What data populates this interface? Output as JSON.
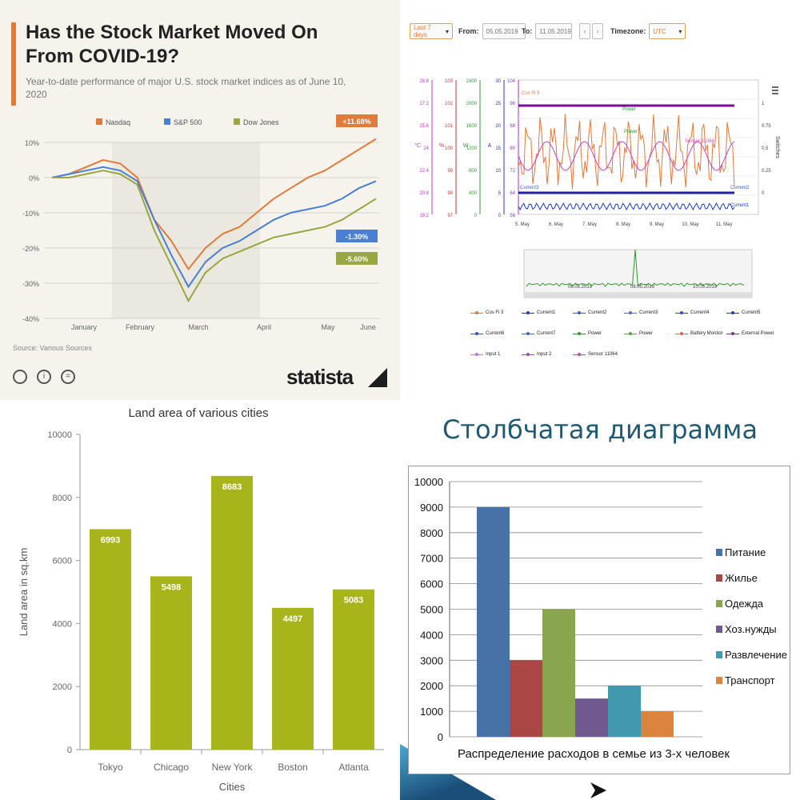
{
  "chart_data": [
    {
      "type": "line",
      "title": "Has the Stock Market Moved On From COVID-19?",
      "subtitle": "Year-to-date performance of major U.S. stock market indices as of June 10, 2020",
      "x": [
        "January",
        "February",
        "March",
        "April",
        "May",
        "June"
      ],
      "ylim": [
        -40,
        10
      ],
      "ytick_labels": [
        "10%",
        "0%",
        "-10%",
        "-20%",
        "-30%",
        "-40%"
      ],
      "legend_placement": "top",
      "series": [
        {
          "name": "Nasdaq",
          "color": "#e07b39",
          "values": [
            0,
            1,
            3,
            5,
            4,
            0,
            -12,
            -18,
            -26,
            -20,
            -16,
            -14,
            -10,
            -6,
            -3,
            0,
            2,
            5,
            8,
            11
          ]
        },
        {
          "name": "S&P 500",
          "color": "#4a7fd4",
          "values": [
            0,
            1,
            2,
            3,
            2,
            -1,
            -12,
            -22,
            -31,
            -24,
            -20,
            -18,
            -15,
            -12,
            -10,
            -9,
            -8,
            -6,
            -3,
            -1
          ]
        },
        {
          "name": "Dow Jones",
          "color": "#9aa641",
          "values": [
            0,
            0,
            1,
            2,
            1,
            -2,
            -15,
            -25,
            -35,
            -27,
            -23,
            -21,
            -19,
            -17,
            -16,
            -15,
            -14,
            -12,
            -9,
            -6
          ]
        }
      ],
      "end_labels": [
        "+11.68%",
        "-1.30%",
        "-5.60%"
      ],
      "source": "Source: Various Sources",
      "brand": "statista"
    },
    {
      "type": "line",
      "controls": {
        "range_label": "Last 7 days",
        "from_label": "From:",
        "from_value": "05.05.2019",
        "to_label": "To:",
        "to_value": "11.05.2019",
        "timezone_label": "Timezone:",
        "timezone_value": "UTC"
      },
      "x": [
        "5. May",
        "6. May",
        "7. May",
        "8. May",
        "9. May",
        "10. May",
        "11. May"
      ],
      "left_axes": [
        {
          "label": "°C",
          "color": "#cc33cc",
          "ticks": [
            "28.8",
            "27.2",
            "25.6",
            "24",
            "22.4",
            "20.8",
            "19.2"
          ]
        },
        {
          "label": "%",
          "color": "#cc3333",
          "ticks": [
            "103",
            "102",
            "101",
            "100",
            "99",
            "98",
            "97"
          ]
        },
        {
          "label": "W",
          "color": "#339933",
          "ticks": [
            "2400",
            "2000",
            "1600",
            "1200",
            "800",
            "400",
            "0"
          ]
        },
        {
          "label": "A",
          "color": "#3333cc",
          "ticks": [
            "30",
            "25",
            "20",
            "15",
            "10",
            "5",
            "0"
          ]
        },
        {
          "label": "",
          "color": "#9933cc",
          "ticks": [
            "104",
            "96",
            "88",
            "80",
            "72",
            "64",
            "56"
          ]
        }
      ],
      "right_axis": {
        "label": "Switches",
        "ticks": [
          "1",
          "0.75",
          "0.5",
          "0.25",
          "0"
        ]
      },
      "series_labels": [
        "Cos Fi 3",
        "Power",
        "Power",
        "Sensor 11064",
        "Current2",
        "Current3",
        "Current1"
      ],
      "navigator_dates": [
        "06.05.2019",
        "08.05.2019",
        "10.05.2019"
      ],
      "legend": [
        {
          "name": "Cos Fi 3",
          "color": "#e07b39"
        },
        {
          "name": "Current1",
          "color": "#1a3ccf"
        },
        {
          "name": "Current2",
          "color": "#3a5bd9"
        },
        {
          "name": "Current3",
          "color": "#4a6ee0"
        },
        {
          "name": "Current4",
          "color": "#2a4fc0"
        },
        {
          "name": "Current5",
          "color": "#1f3fb0"
        },
        {
          "name": "Current6",
          "color": "#3550d0"
        },
        {
          "name": "Current7",
          "color": "#4060e0"
        },
        {
          "name": "Power",
          "color": "#2a9c2a"
        },
        {
          "name": "Power",
          "color": "#49b049"
        },
        {
          "name": "Battery Monitor",
          "color": "#e06060"
        },
        {
          "name": "External Power",
          "color": "#8a2aa0"
        },
        {
          "name": "Input 1",
          "color": "#b07ad0"
        },
        {
          "name": "Input 2",
          "color": "#9a4ac0"
        },
        {
          "name": "Sensor 11064",
          "color": "#d040c0"
        }
      ]
    },
    {
      "type": "bar",
      "title": "Land area of various cities",
      "xlabel": "Cities",
      "ylabel": "Land area in sq.km",
      "categories": [
        "Tokyo",
        "Chicago",
        "New York",
        "Boston",
        "Atlanta"
      ],
      "values": [
        6993,
        5498,
        8683,
        4497,
        5083
      ],
      "ylim": [
        0,
        10000
      ],
      "ytick_labels": [
        "0",
        "2000",
        "4000",
        "6000",
        "8000",
        "10000"
      ],
      "color": "#a8b51a"
    },
    {
      "type": "bar",
      "heading": "Столбчатая диаграмма",
      "xlabel": "Распределение расходов в семье из 3-х человек",
      "ylim": [
        0,
        10000
      ],
      "ytick_labels": [
        "0",
        "1000",
        "2000",
        "3000",
        "4000",
        "5000",
        "6000",
        "7000",
        "8000",
        "9000",
        "10000"
      ],
      "legend_placement": "right",
      "series": [
        {
          "name": "Питание",
          "values": [
            9000
          ],
          "color": "#4672a8"
        },
        {
          "name": "Жилье",
          "values": [
            3000
          ],
          "color": "#aa4643"
        },
        {
          "name": "Одежда",
          "values": [
            5000
          ],
          "color": "#89a54e"
        },
        {
          "name": "Хоз.нужды",
          "values": [
            1500
          ],
          "color": "#71588f"
        },
        {
          "name": "Развлечение",
          "values": [
            2000
          ],
          "color": "#4198af"
        },
        {
          "name": "Транспорт",
          "values": [
            1000
          ],
          "color": "#db843d"
        }
      ]
    }
  ]
}
